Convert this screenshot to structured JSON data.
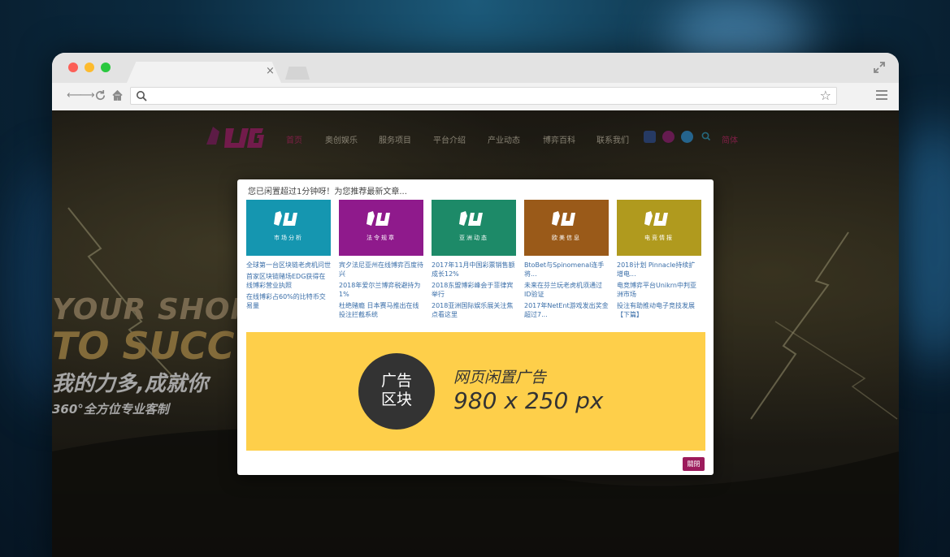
{
  "browser": {
    "url_value": "",
    "url_placeholder": ""
  },
  "site": {
    "nav": [
      "首页",
      "奥创娱乐",
      "服务项目",
      "平台介绍",
      "产业动态",
      "博弈百科",
      "联系我们"
    ],
    "lang": "简体",
    "hero": {
      "line1": "YOUR SHOR",
      "line2": "TO SUCC",
      "line3": "我的力多,成就你",
      "line4": "360°全方位专业客制"
    }
  },
  "modal": {
    "header": "您已闲置超过1分钟呀！为您推荐最新文章...",
    "cards": [
      {
        "category": "市场分析",
        "color": "#1596b0",
        "links": [
          "全球第一台区块链老虎机问世",
          "首家区块链赌场EDG获得在线博彩营业执照",
          "在线博彩占60%的比特币交易量"
        ]
      },
      {
        "category": "法令规章",
        "color": "#8f1a8c",
        "links": [
          "宾夕法尼亚州在线博弈百度待兴",
          "2018年爱尔兰博弈税避持为1%",
          "杜绝赌瘾 日本赛马推出在线投注拦截系统"
        ]
      },
      {
        "category": "亚洲动态",
        "color": "#1d8a68",
        "links": [
          "2017年11月中国彩票销售额成长12%",
          "2018东盟博彩峰会于菲律宾举行",
          "2018亚洲国际娱乐展关注焦点看这里"
        ]
      },
      {
        "category": "欧美信息",
        "color": "#9a5a19",
        "links": [
          "BtoBet与Spinomenal连手将...",
          "未来在芬兰玩老虎机须通过ID验证",
          "2017年NetEnt游戏发出奖金超过7..."
        ]
      },
      {
        "category": "电竞情报",
        "color": "#b09a1e",
        "links": [
          "2018计划 Pinnacle持续扩增电...",
          "电竞博弈平台Unikrn中判亚洲市场",
          "投注有助推动电子竞技发展【下篇】"
        ]
      }
    ],
    "ad": {
      "badge_line1": "广告",
      "badge_line2": "区块",
      "title": "网页闲置广告",
      "size": "980 x 250 px"
    },
    "close_label": "關閉"
  },
  "colors": {
    "accent": "#9c1b5c",
    "ad_background": "#fecf4a",
    "link": "#3a6ea8"
  },
  "icons": [
    "search-icon",
    "star-icon",
    "menu-icon",
    "expand-icon",
    "home-icon",
    "reload-icon",
    "facebook-icon",
    "instagram-icon",
    "twitter-icon"
  ]
}
